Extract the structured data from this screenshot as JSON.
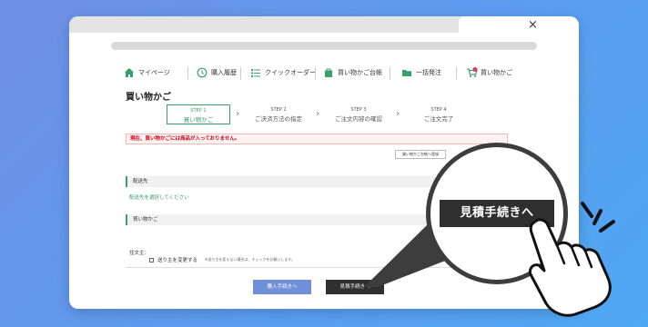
{
  "browser": {
    "close_glyph": "×"
  },
  "nav": {
    "items": [
      {
        "label": "マイページ",
        "icon": "house-icon"
      },
      {
        "label": "購入履歴",
        "icon": "clock-icon"
      },
      {
        "label": "クイックオーダー",
        "icon": "list-icon"
      },
      {
        "label": "買い物かご台帳",
        "icon": "bag-icon"
      },
      {
        "label": "一括発注",
        "icon": "folder-icon"
      },
      {
        "label": "買い物かご",
        "icon": "cart-icon",
        "badge": "0"
      }
    ]
  },
  "page": {
    "title": "買い物かご"
  },
  "steps": [
    {
      "num": "STEP 1",
      "label": "買い物かご",
      "active": true
    },
    {
      "num": "STEP 2",
      "label": "ご決済方法の指定",
      "active": false
    },
    {
      "num": "STEP 3",
      "label": "ご注文内容の確認",
      "active": false
    },
    {
      "num": "STEP 4",
      "label": "ご注文完了",
      "active": false
    }
  ],
  "alert": {
    "text": "現在、買い物かごには商品が入っておりません。"
  },
  "cart_ledger_button": "買い物かご台帳へ登録",
  "sections": {
    "delivery": {
      "label": "配送先",
      "link": "配送先を選択してください"
    },
    "cart": {
      "label": "買い物かご"
    }
  },
  "order_memo": {
    "label": "住文主：",
    "checkbox_label": "送り主を変更する",
    "note": "※送り主を変えない場合は、チェックをお願いします。"
  },
  "buttons": {
    "purchase": "購入手続きへ",
    "quote": "見積手続きへ"
  },
  "colors": {
    "background": "#5a9ef0",
    "accent_green": "#3aa06b",
    "purchase_button": "#6f8fd8",
    "quote_button": "#2f2f2f",
    "alert_red": "#d0021b"
  }
}
